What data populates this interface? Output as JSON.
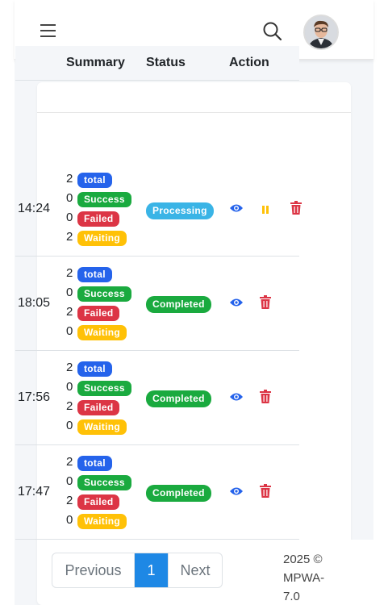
{
  "colors": {
    "total": "#2563eb",
    "success": "#1aaa3f",
    "failed": "#dc3545",
    "waiting": "#ffc107",
    "processing": "#3ab4e6",
    "completed": "#1aaa3f",
    "view": "#2563eb",
    "pause": "#ffc107",
    "delete": "#dc3545",
    "active_page": "#1e88e5"
  },
  "topbar": {
    "menu_icon": "hamburger-icon",
    "search_icon": "search-icon",
    "avatar": "user-avatar"
  },
  "table": {
    "headers": {
      "time": "",
      "summary": "Summary",
      "status": "Status",
      "action": "Action"
    },
    "rows": [
      {
        "time": "14:24",
        "total": "2",
        "success": "0",
        "failed": "0",
        "waiting": "2",
        "total_label": "total",
        "success_label": "Success",
        "failed_label": "Failed",
        "waiting_label": "Waiting",
        "status": "Processing",
        "actions": [
          "eye-icon",
          "pause-icon",
          "trash-icon"
        ]
      },
      {
        "time": "18:05",
        "total": "2",
        "success": "0",
        "failed": "2",
        "waiting": "0",
        "total_label": "total",
        "success_label": "Success",
        "failed_label": "Failed",
        "waiting_label": "Waiting",
        "status": "Completed",
        "actions": [
          "eye-icon",
          "trash-icon"
        ]
      },
      {
        "time": "17:56",
        "total": "2",
        "success": "0",
        "failed": "2",
        "waiting": "0",
        "total_label": "total",
        "success_label": "Success",
        "failed_label": "Failed",
        "waiting_label": "Waiting",
        "status": "Completed",
        "actions": [
          "eye-icon",
          "trash-icon"
        ]
      },
      {
        "time": "17:47",
        "total": "2",
        "success": "0",
        "failed": "2",
        "waiting": "0",
        "total_label": "total",
        "success_label": "Success",
        "failed_label": "Failed",
        "waiting_label": "Waiting",
        "status": "Completed",
        "actions": [
          "eye-icon",
          "trash-icon"
        ]
      }
    ]
  },
  "pagination": {
    "previous": "Previous",
    "current": "1",
    "next": "Next"
  },
  "footer": {
    "line1": "2025 ©",
    "line2": "MPWA-",
    "line3": "7.0"
  }
}
